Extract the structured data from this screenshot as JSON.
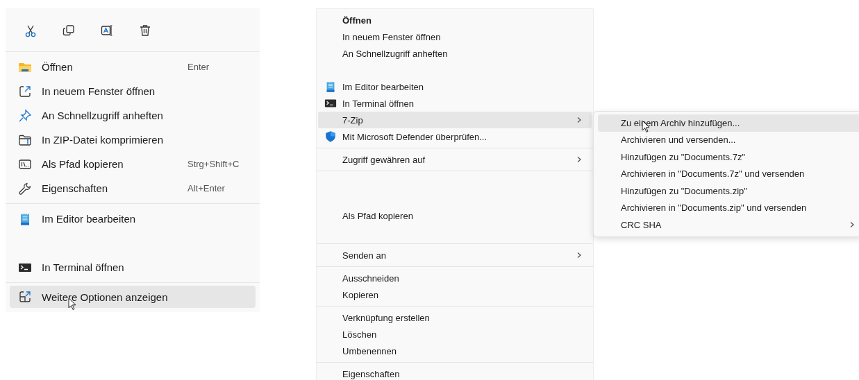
{
  "quick_menu": {
    "toolbar": [
      {
        "kind": "cut"
      },
      {
        "kind": "copy"
      },
      {
        "kind": "rename"
      },
      {
        "kind": "delete"
      }
    ],
    "groups": [
      [
        {
          "kind": "folder",
          "label": "Öffnen",
          "shortcut": "Enter",
          "selected": false
        },
        {
          "kind": "new-window",
          "label": "In neuem Fenster öffnen",
          "selected": false
        },
        {
          "kind": "pin",
          "label": "An Schnellzugriff anheften",
          "selected": false
        },
        {
          "kind": "zip",
          "label": "In ZIP-Datei komprimieren",
          "selected": false
        },
        {
          "kind": "path",
          "label": "Als Pfad kopieren",
          "shortcut": "Strg+Shift+C",
          "selected": false
        },
        {
          "kind": "wrench",
          "label": "Eigenschaften",
          "shortcut": "Alt+Enter",
          "selected": false
        }
      ],
      [
        {
          "kind": "notepad",
          "label": "Im Editor bearbeiten",
          "selected": false
        },
        {
          "kind": "blank"
        },
        {
          "kind": "terminal",
          "label": "In Terminal öffnen",
          "selected": false
        }
      ],
      [
        {
          "kind": "expand",
          "label": "Weitere Optionen anzeigen",
          "selected": true,
          "cursor": true
        }
      ]
    ]
  },
  "classic_menu": {
    "groups": [
      [
        {
          "kind": "plain",
          "label": "Öffnen",
          "bold": true,
          "selected": false
        },
        {
          "kind": "plain",
          "label": "In neuem Fenster öffnen",
          "selected": false
        },
        {
          "kind": "plain",
          "label": "An Schnellzugriff anheften",
          "selected": false
        },
        {
          "kind": "blank"
        },
        {
          "kind": "notepad",
          "label": "Im Editor bearbeiten",
          "selected": false
        },
        {
          "kind": "terminal",
          "label": "In Terminal öffnen",
          "selected": false
        },
        {
          "kind": "plain",
          "label": "7-Zip",
          "submenu": true,
          "selected": true
        },
        {
          "kind": "shield",
          "label": "Mit Microsoft Defender überprüfen...",
          "selected": false
        }
      ],
      [
        {
          "kind": "plain",
          "label": "Zugriff gewähren auf",
          "submenu": true,
          "selected": false
        }
      ],
      [
        {
          "kind": "blank"
        },
        {
          "kind": "blank"
        },
        {
          "kind": "plain",
          "label": "Als Pfad kopieren",
          "selected": false
        },
        {
          "kind": "blank"
        }
      ],
      [
        {
          "kind": "plain",
          "label": "Senden an",
          "submenu": true,
          "selected": false
        }
      ],
      [
        {
          "kind": "plain",
          "label": "Ausschneiden",
          "selected": false
        },
        {
          "kind": "plain",
          "label": "Kopieren",
          "selected": false
        }
      ],
      [
        {
          "kind": "plain",
          "label": "Verknüpfung erstellen",
          "selected": false
        },
        {
          "kind": "plain",
          "label": "Löschen",
          "selected": false
        },
        {
          "kind": "plain",
          "label": "Umbenennen",
          "selected": false
        }
      ],
      [
        {
          "kind": "plain",
          "label": "Eigenschaften",
          "selected": false
        }
      ]
    ]
  },
  "zip_submenu": {
    "items": [
      {
        "label": "Zu einem Archiv hinzufügen...",
        "selected": true,
        "cursor": true
      },
      {
        "label": "Archivieren und versenden...",
        "selected": false
      },
      {
        "label": "Hinzufügen zu \"Documents.7z\"",
        "selected": false
      },
      {
        "label": "Archivieren in \"Documents.7z\" und versenden",
        "selected": false
      },
      {
        "label": "Hinzufügen zu \"Documents.zip\"",
        "selected": false
      },
      {
        "label": "Archivieren in \"Documents.zip\" und versenden",
        "selected": false
      },
      {
        "label": "CRC SHA",
        "submenu": true,
        "selected": false
      }
    ]
  }
}
